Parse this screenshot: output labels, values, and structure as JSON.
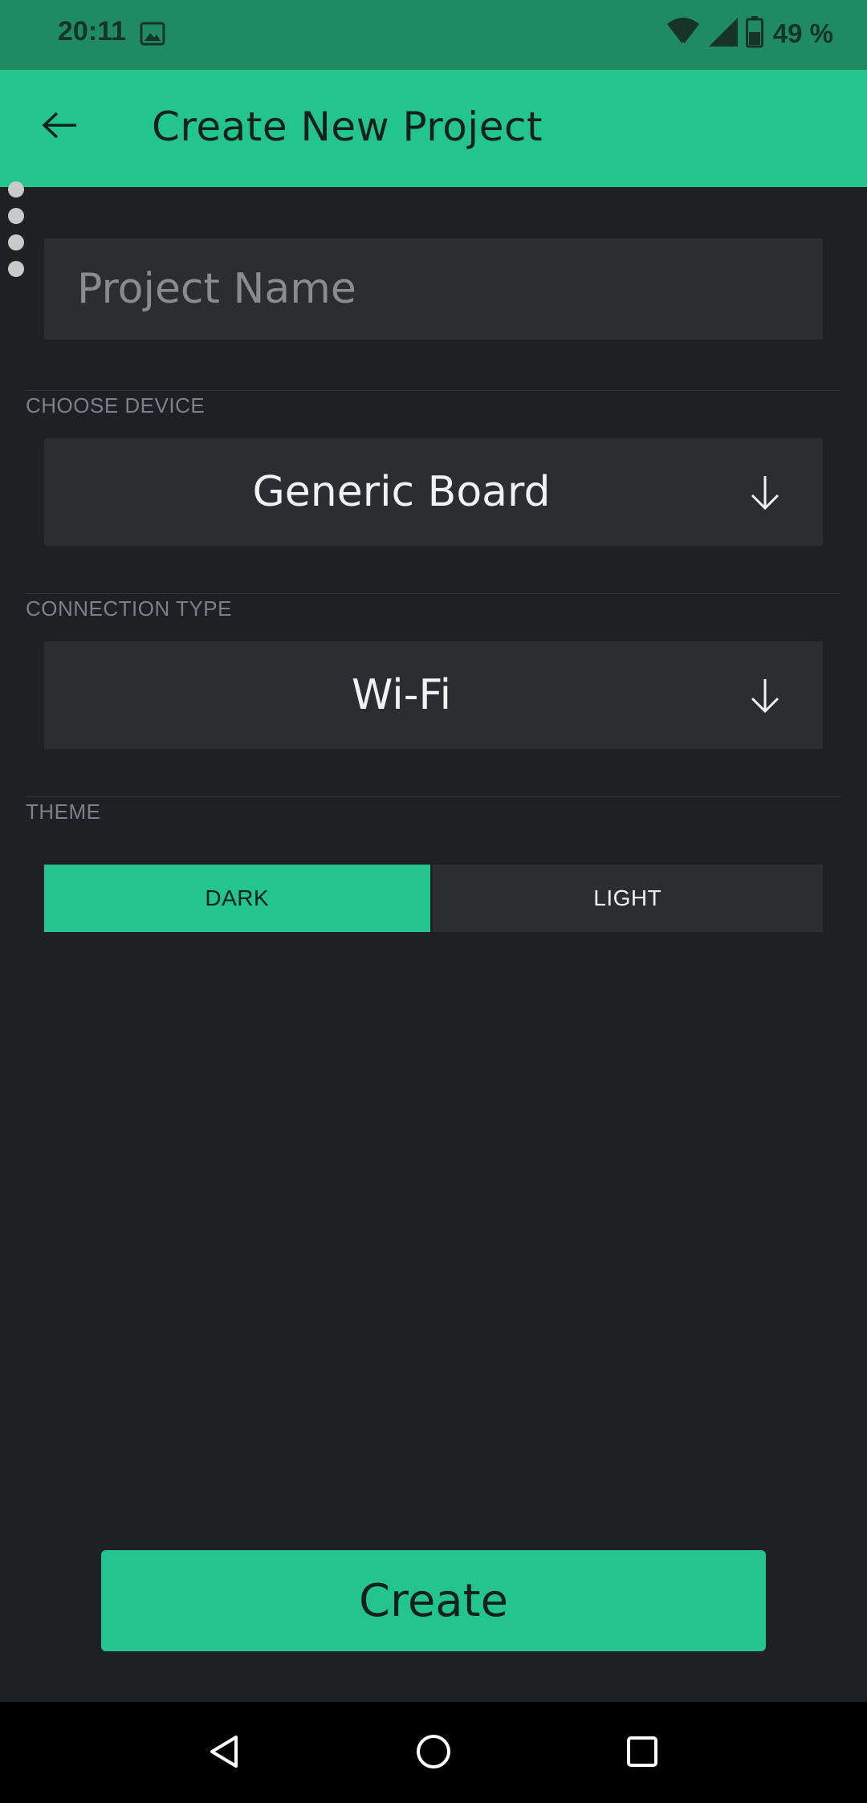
{
  "status_bar": {
    "time": "20:11",
    "battery": "49 %",
    "icons": [
      "gallery-icon",
      "wifi-icon",
      "signal-icon",
      "battery-icon"
    ]
  },
  "app_bar": {
    "title": "Create New Project",
    "back_icon": "back-arrow-icon"
  },
  "form": {
    "project_name": {
      "placeholder": "Project Name",
      "value": ""
    },
    "device": {
      "label": "CHOOSE DEVICE",
      "value": "Generic Board",
      "icon": "arrow-down-icon"
    },
    "connection": {
      "label": "CONNECTION TYPE",
      "value": "Wi-Fi",
      "icon": "arrow-down-icon"
    },
    "theme": {
      "label": "THEME",
      "options": [
        "DARK",
        "LIGHT"
      ],
      "selected": "DARK"
    }
  },
  "actions": {
    "create_label": "Create"
  },
  "nav": {
    "icons": [
      "back-icon",
      "home-icon",
      "recents-icon"
    ]
  },
  "colors": {
    "accent": "#23c48e",
    "status_bar": "#1f8a63",
    "background": "#1f2024",
    "surface": "#2c2d31",
    "label": "#7e8086"
  }
}
